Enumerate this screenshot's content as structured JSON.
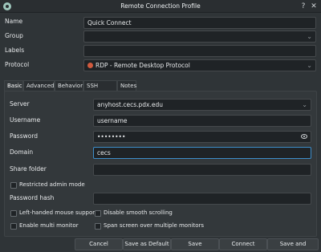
{
  "window": {
    "title": "Remote Connection Profile",
    "help": "?",
    "close": "✕"
  },
  "labels": {
    "name": "Name",
    "group": "Group",
    "labels": "Labels",
    "protocol": "Protocol"
  },
  "fields": {
    "name": "Quick Connect",
    "group": "",
    "labels": "",
    "protocol": "RDP - Remote Desktop Protocol"
  },
  "tabs": [
    "Basic",
    "Advanced",
    "Behavior",
    "SSH Tunnel",
    "Notes"
  ],
  "basic": {
    "server_label": "Server",
    "server_value": "anyhost.cecs.pdx.edu",
    "username_label": "Username",
    "username_value": "username",
    "password_label": "Password",
    "password_value": "••••••••",
    "domain_label": "Domain",
    "domain_value": "cecs",
    "share_folder_label": "Share folder",
    "restricted_admin_label": "Restricted admin mode",
    "password_hash_label": "Password hash",
    "left_handed_label": "Left-handed mouse support",
    "disable_smooth_label": "Disable smooth scrolling",
    "multi_monitor_label": "Enable multi monitor",
    "span_screen_label": "Span screen over multiple monitors"
  },
  "buttons": {
    "cancel": "Cancel",
    "save_default": "Save as Default",
    "save": "Save",
    "connect": "Connect",
    "save_connect": "Save and Connect"
  },
  "colors": {
    "accent": "#3d8dc9",
    "background": "#2f3437",
    "field": "#1f2326"
  }
}
